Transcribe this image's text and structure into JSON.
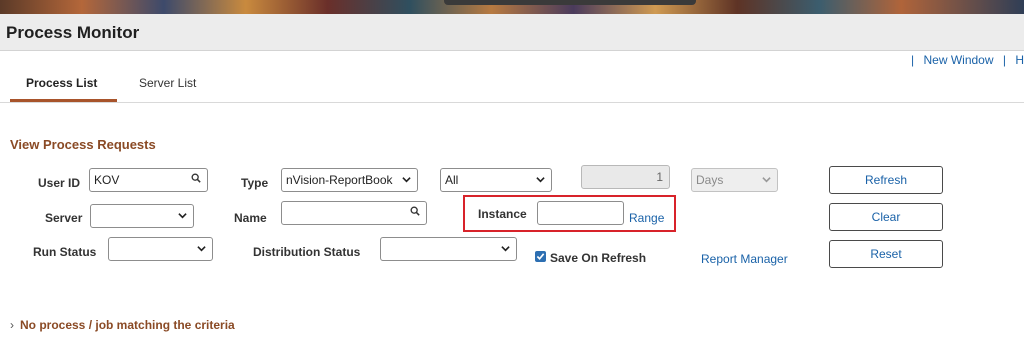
{
  "window": {
    "title": "Process Monitor"
  },
  "top_links": {
    "separator": "|",
    "new_window": "New Window",
    "more_truncated": "H"
  },
  "tabs": [
    {
      "label": "Process List",
      "active": true
    },
    {
      "label": "Server List",
      "active": false
    }
  ],
  "section": {
    "title": "View Process Requests"
  },
  "filters": {
    "user_id": {
      "label": "User ID",
      "value": "KOV"
    },
    "type": {
      "label": "Type",
      "value": "nVision-ReportBook"
    },
    "type_scope": {
      "value": "All"
    },
    "last": {
      "value": "1"
    },
    "unit": {
      "value": "Days"
    },
    "server": {
      "label": "Server",
      "value": ""
    },
    "name": {
      "label": "Name",
      "value": ""
    },
    "instance": {
      "label": "Instance",
      "value": ""
    },
    "range_link": "Range",
    "run_status": {
      "label": "Run Status",
      "value": ""
    },
    "distribution_status": {
      "label": "Distribution Status",
      "value": ""
    },
    "save_on_refresh": {
      "label": "Save On Refresh",
      "checked": true
    }
  },
  "links": {
    "report_manager": "Report Manager"
  },
  "buttons": {
    "refresh": "Refresh",
    "clear": "Clear",
    "reset": "Reset"
  },
  "results": {
    "message": "No process / job matching the criteria"
  },
  "colors": {
    "accent": "#8a4a25",
    "link": "#1a62a8",
    "highlight": "#d8232a",
    "checkbox": "#2d6fb2"
  },
  "icons": [
    "search-icon",
    "chevron-down-icon",
    "checkmark-icon",
    "chevron-right-icon"
  ]
}
